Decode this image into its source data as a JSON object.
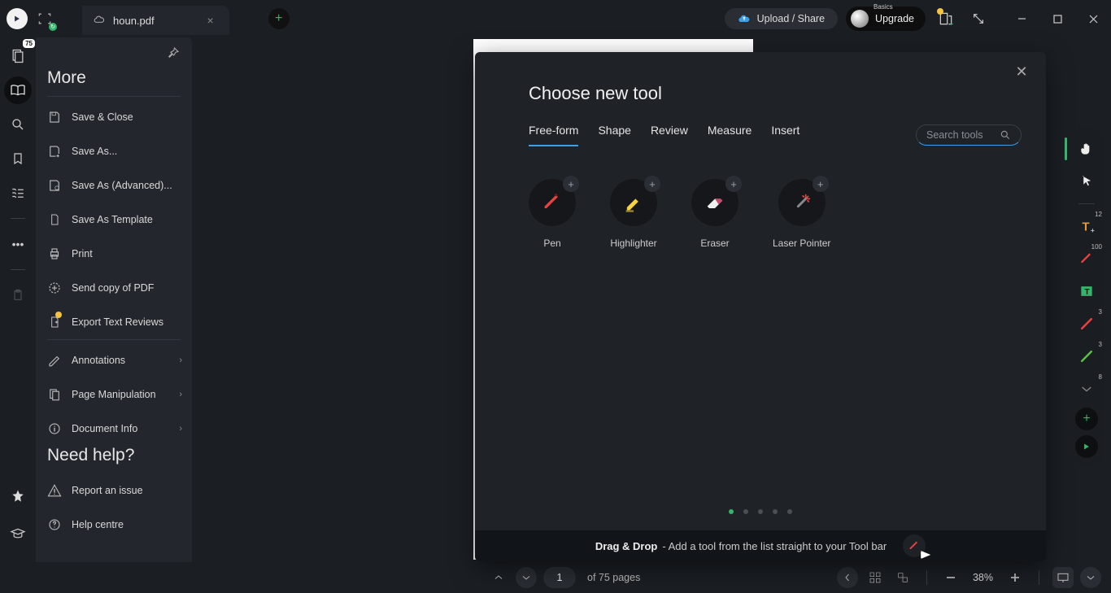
{
  "window": {
    "title": "houn.pdf"
  },
  "titlebar": {
    "upload_label": "Upload / Share",
    "upgrade_badge": "Basics",
    "upgrade_label": "Upgrade"
  },
  "vstrip": {
    "page_badge": "75"
  },
  "morePanel": {
    "title": "More",
    "items": [
      {
        "label": "Save & Close",
        "icon": "save-close"
      },
      {
        "label": "Save As...",
        "icon": "save-as"
      },
      {
        "label": "Save As (Advanced)...",
        "icon": "save-adv"
      },
      {
        "label": "Save As Template",
        "icon": "save-tpl"
      },
      {
        "label": "Print",
        "icon": "print"
      },
      {
        "label": "Send copy of PDF",
        "icon": "send"
      },
      {
        "label": "Export Text Reviews",
        "icon": "export",
        "dot": true
      },
      {
        "label": "Annotations",
        "icon": "annot",
        "chev": true
      },
      {
        "label": "Page Manipulation",
        "icon": "pages",
        "chev": true
      },
      {
        "label": "Document Info",
        "icon": "info",
        "chev": true
      }
    ],
    "help_title": "Need help?",
    "help_items": [
      {
        "label": "Report an issue",
        "icon": "report"
      },
      {
        "label": "Help centre",
        "icon": "help"
      }
    ]
  },
  "modal": {
    "title": "Choose new tool",
    "tabs": [
      "Free-form",
      "Shape",
      "Review",
      "Measure",
      "Insert"
    ],
    "active_tab": 0,
    "search_placeholder": "Search tools",
    "tools": [
      {
        "label": "Pen",
        "icon": "pen"
      },
      {
        "label": "Highlighter",
        "icon": "highlighter"
      },
      {
        "label": "Eraser",
        "icon": "eraser"
      },
      {
        "label": "Laser Pointer",
        "icon": "laser"
      }
    ],
    "dnd_title": "Drag & Drop",
    "dnd_desc": "- Add a tool from the list straight to your Tool bar"
  },
  "rtoolbar": {
    "items": [
      {
        "name": "pan-hand-icon",
        "active": true
      },
      {
        "name": "select-pointer-icon"
      }
    ],
    "tool_items": [
      {
        "name": "text-t-icon",
        "badge": "12",
        "color": "#e39b3c",
        "bg": true
      },
      {
        "name": "pen-tool-icon",
        "badge": "100",
        "color": "#e84343"
      },
      {
        "name": "text-box-icon",
        "color": "#35b56b",
        "bg": true
      },
      {
        "name": "red-line-icon",
        "badge": "3",
        "color": "#e84343"
      },
      {
        "name": "green-line-icon",
        "badge": "3",
        "color": "#5bbf4a"
      },
      {
        "name": "chevron-down-icon",
        "badge": "8",
        "color": "#888"
      }
    ]
  },
  "footer": {
    "page_current": "1",
    "page_total": "of 75 pages",
    "zoom": "38%"
  },
  "colors": {
    "accent_green": "#35b56b",
    "accent_blue": "#3aa0e9"
  }
}
